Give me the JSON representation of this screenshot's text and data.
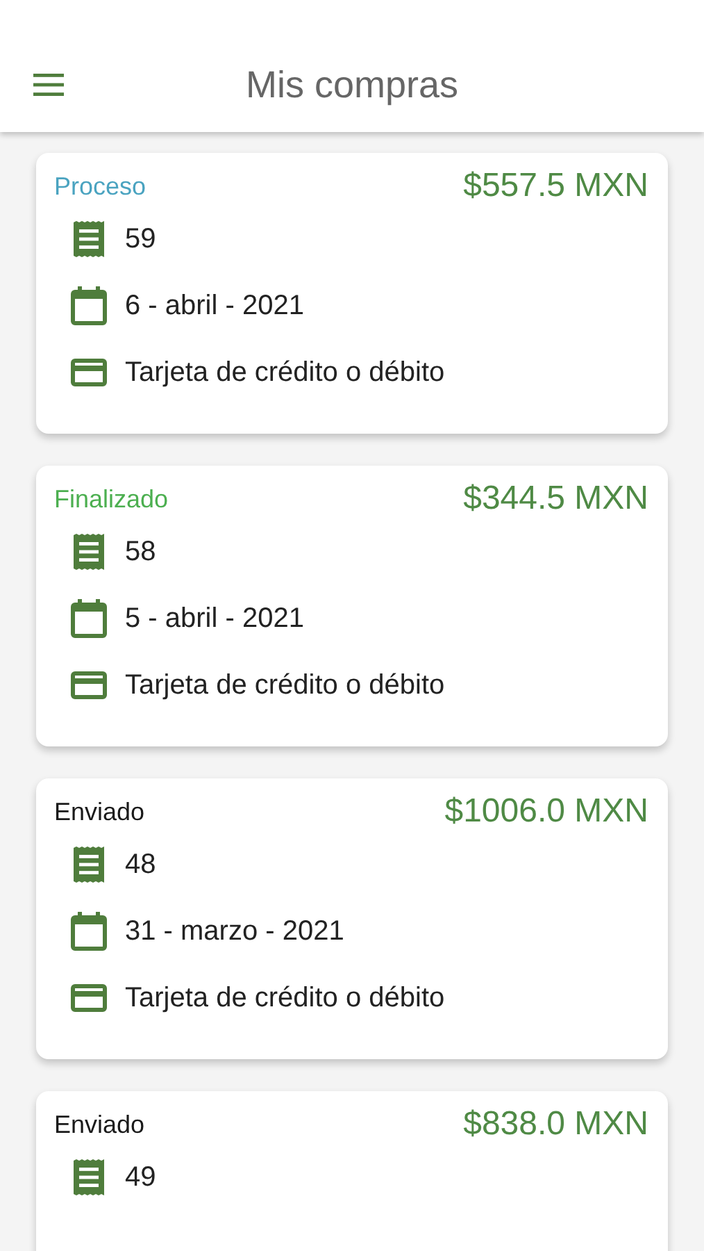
{
  "app_bar": {
    "title": "Mis compras"
  },
  "orders": [
    {
      "status": "Proceso",
      "color": "#4aa3c0",
      "total": "$557.5 MXN",
      "number": "59",
      "date": "6 - abril - 2021",
      "payment": "Tarjeta de crédito o débito"
    },
    {
      "status": "Finalizado",
      "color": "#4caf50",
      "total": "$344.5 MXN",
      "number": "58",
      "date": "5 - abril - 2021",
      "payment": "Tarjeta de crédito o débito"
    },
    {
      "status": "Enviado",
      "color": "#1a1a1a",
      "total": "$1006.0 MXN",
      "number": "48",
      "date": "31 - marzo - 2021",
      "payment": "Tarjeta de crédito o débito"
    },
    {
      "status": "Enviado",
      "color": "#1a1a1a",
      "total": "$838.0 MXN",
      "number": "49"
    }
  ]
}
